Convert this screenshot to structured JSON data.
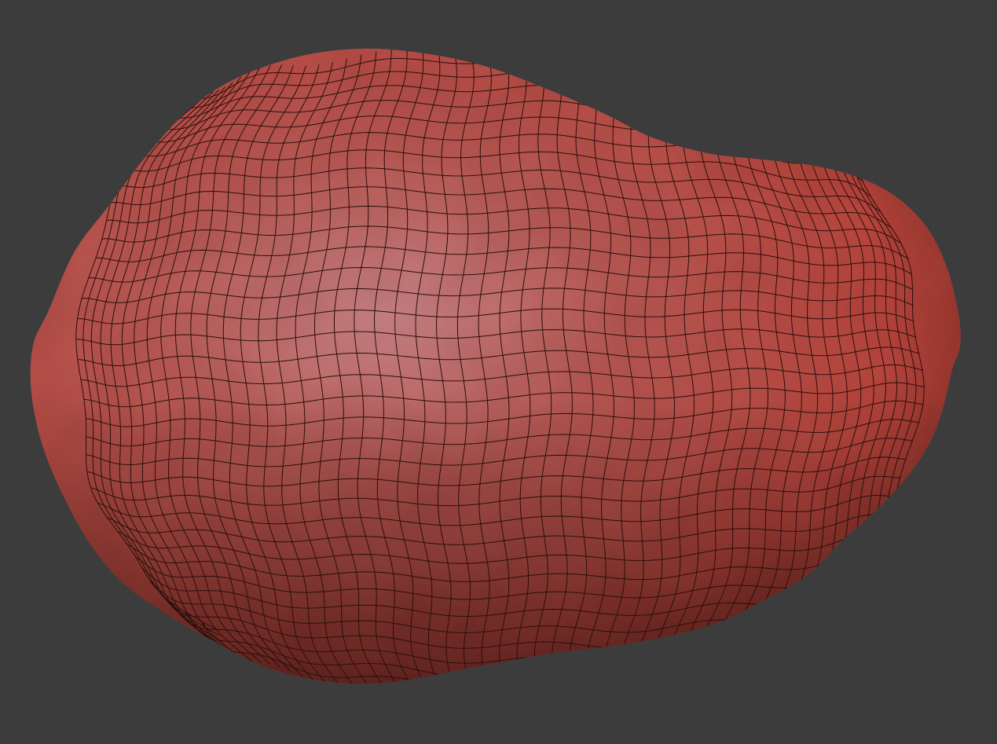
{
  "viewport": {
    "background_color": "#3c3c3d",
    "object": {
      "kind": "sculpted-blob-mesh",
      "material_color": "#b8473e",
      "highlight_color": "#c98688",
      "shadow_color": "#5a1d18",
      "wireframe_color": "#2a0f0c",
      "wireframe_visible": true
    }
  }
}
